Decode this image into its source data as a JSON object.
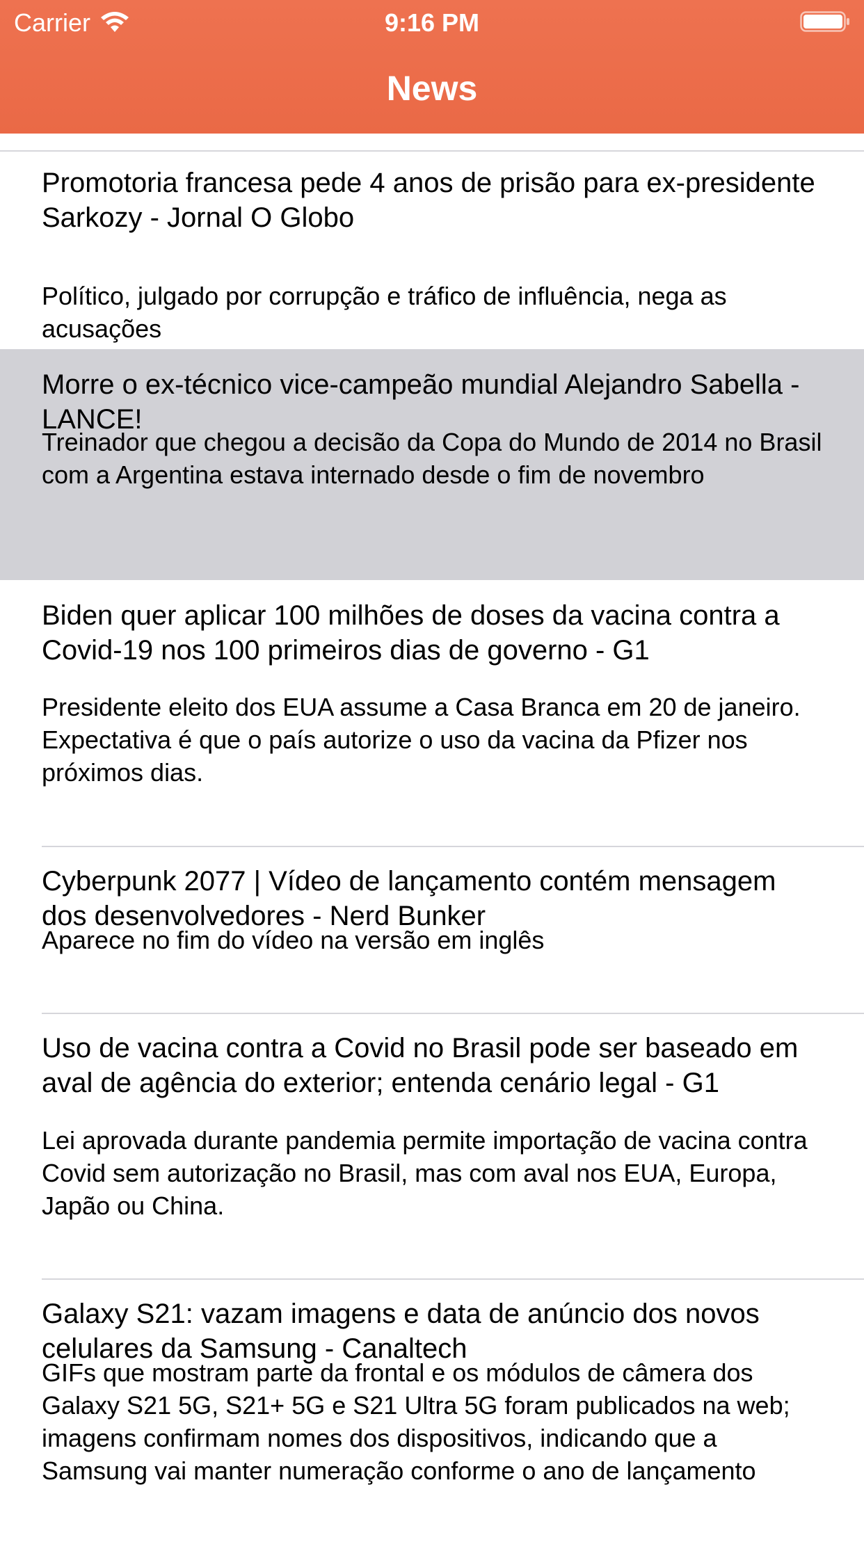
{
  "status_bar": {
    "carrier": "Carrier",
    "time": "9:16 PM"
  },
  "nav": {
    "title": "News"
  },
  "colors": {
    "header": "#ec6c48",
    "selected_row": "#d1d1d6",
    "separator": "#d6d6db"
  },
  "articles": [
    {
      "title": "Promotoria francesa pede 4 anos de prisão para ex-presidente Sarkozy - Jornal O Globo",
      "description": "Político, julgado por corrupção e tráfico de influência, nega as acusações"
    },
    {
      "title": "Morre o ex-técnico vice-campeão mundial Alejandro Sabella - LANCE!",
      "description": "Treinador que chegou a decisão da Copa do Mundo de 2014 no Brasil com a Argentina estava internado desde o fim de novembro",
      "selected": true
    },
    {
      "title": "Biden quer aplicar 100 milhões de doses da vacina contra a Covid-19 nos 100 primeiros dias de governo - G1",
      "description": "Presidente eleito dos EUA assume a Casa Branca em 20 de janeiro. Expectativa é que o país autorize o uso da vacina da Pfizer nos próximos dias."
    },
    {
      "title": "Cyberpunk 2077 | Vídeo de lançamento contém mensagem dos desenvolvedores - Nerd Bunker",
      "description": "Aparece no fim do vídeo na versão em inglês"
    },
    {
      "title": "Uso de vacina contra a Covid no Brasil pode ser baseado em aval de agência do exterior; entenda cenário legal - G1",
      "description": "Lei aprovada durante pandemia permite importação de vacina contra Covid sem autorização no Brasil, mas com aval nos EUA, Europa, Japão ou China."
    },
    {
      "title": "Galaxy S21: vazam imagens e data de anúncio dos novos celulares da Samsung - Canaltech",
      "description": "GIFs que mostram parte da frontal e os módulos de câmera dos Galaxy S21 5G, S21+ 5G e S21 Ultra 5G foram publicados na web; imagens confirmam nomes dos dispositivos, indicando que a Samsung vai manter numeração conforme o ano de lançamento"
    }
  ]
}
